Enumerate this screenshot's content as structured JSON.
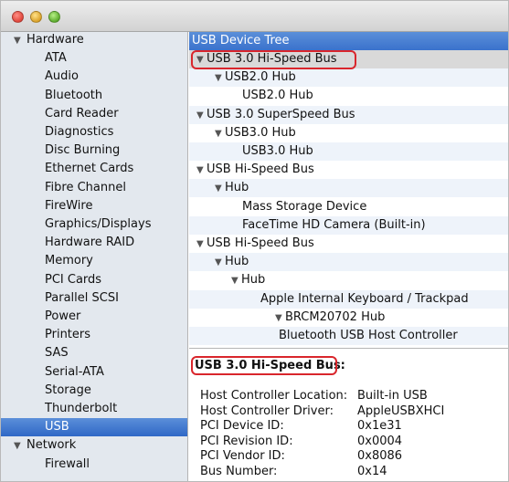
{
  "sidebar": {
    "hardware_label": "Hardware",
    "hardware_items": [
      "ATA",
      "Audio",
      "Bluetooth",
      "Card Reader",
      "Diagnostics",
      "Disc Burning",
      "Ethernet Cards",
      "Fibre Channel",
      "FireWire",
      "Graphics/Displays",
      "Hardware RAID",
      "Memory",
      "PCI Cards",
      "Parallel SCSI",
      "Power",
      "Printers",
      "SAS",
      "Serial-ATA",
      "Storage",
      "Thunderbolt",
      "USB"
    ],
    "selected_item": "USB",
    "network_label": "Network",
    "network_items": [
      "Firewall"
    ]
  },
  "tree": {
    "header": "USB Device Tree",
    "rows": [
      {
        "label": "USB 3.0 Hi-Speed Bus",
        "expanded": true
      },
      {
        "label": "USB2.0 Hub",
        "expanded": true
      },
      {
        "label": "USB2.0 Hub",
        "expanded": false
      },
      {
        "label": "USB 3.0 SuperSpeed Bus",
        "expanded": true
      },
      {
        "label": "USB3.0 Hub",
        "expanded": true
      },
      {
        "label": "USB3.0 Hub",
        "expanded": false
      },
      {
        "label": "USB Hi-Speed Bus",
        "expanded": true
      },
      {
        "label": "Hub",
        "expanded": true
      },
      {
        "label": "Mass Storage Device",
        "expanded": false
      },
      {
        "label": "FaceTime HD Camera (Built-in)",
        "expanded": false
      },
      {
        "label": "USB Hi-Speed Bus",
        "expanded": true
      },
      {
        "label": "Hub",
        "expanded": true
      },
      {
        "label": "Hub",
        "expanded": true
      },
      {
        "label": "Apple Internal Keyboard / Trackpad",
        "expanded": false
      },
      {
        "label": "BRCM20702 Hub",
        "expanded": true
      },
      {
        "label": "Bluetooth USB Host Controller",
        "expanded": false
      }
    ]
  },
  "detail": {
    "title": "USB 3.0 Hi-Speed Bus:",
    "properties": [
      {
        "key": "Host Controller Location:",
        "value": "Built-in USB"
      },
      {
        "key": "Host Controller Driver:",
        "value": "AppleUSBXHCI"
      },
      {
        "key": "PCI Device ID:",
        "value": "0x1e31"
      },
      {
        "key": "PCI Revision ID:",
        "value": "0x0004"
      },
      {
        "key": "PCI Vendor ID:",
        "value": "0x8086"
      },
      {
        "key": "Bus Number:",
        "value": "0x14"
      }
    ]
  },
  "colors": {
    "selection": "#2f68c6",
    "annotation_circle": "#d9262c"
  }
}
